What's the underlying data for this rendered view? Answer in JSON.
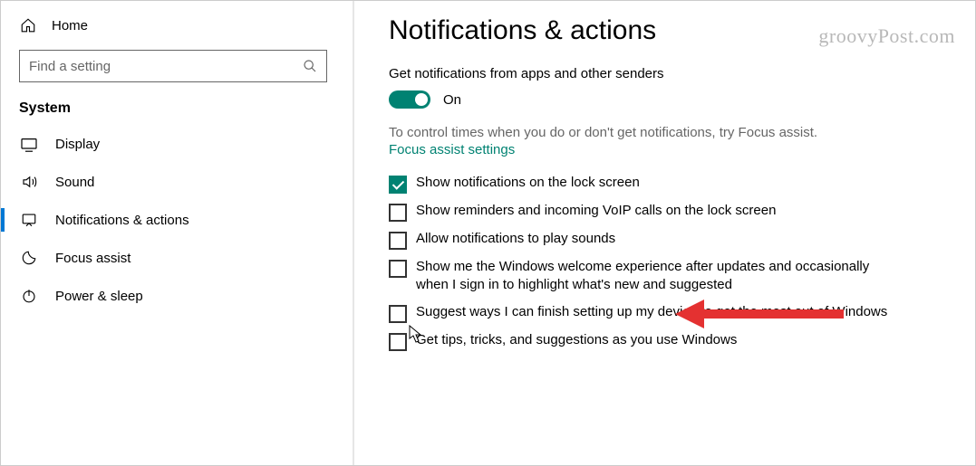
{
  "sidebar": {
    "home": "Home",
    "search_placeholder": "Find a setting",
    "section": "System",
    "items": [
      {
        "label": "Display"
      },
      {
        "label": "Sound"
      },
      {
        "label": "Notifications & actions"
      },
      {
        "label": "Focus assist"
      },
      {
        "label": "Power & sleep"
      }
    ]
  },
  "content": {
    "title": "Notifications & actions",
    "sub": "Get notifications from apps and other senders",
    "toggle_state": "On",
    "helper": "To control times when you do or don't get notifications, try Focus assist.",
    "link": "Focus assist settings",
    "checks": [
      "Show notifications on the lock screen",
      "Show reminders and incoming VoIP calls on the lock screen",
      "Allow notifications to play sounds",
      "Show me the Windows welcome experience after updates and occasionally when I sign in to highlight what's new and suggested",
      "Suggest ways I can finish setting up my device to get the most out of Windows",
      "Get tips, tricks, and suggestions as you use Windows"
    ]
  },
  "watermark": "groovyPost.com"
}
